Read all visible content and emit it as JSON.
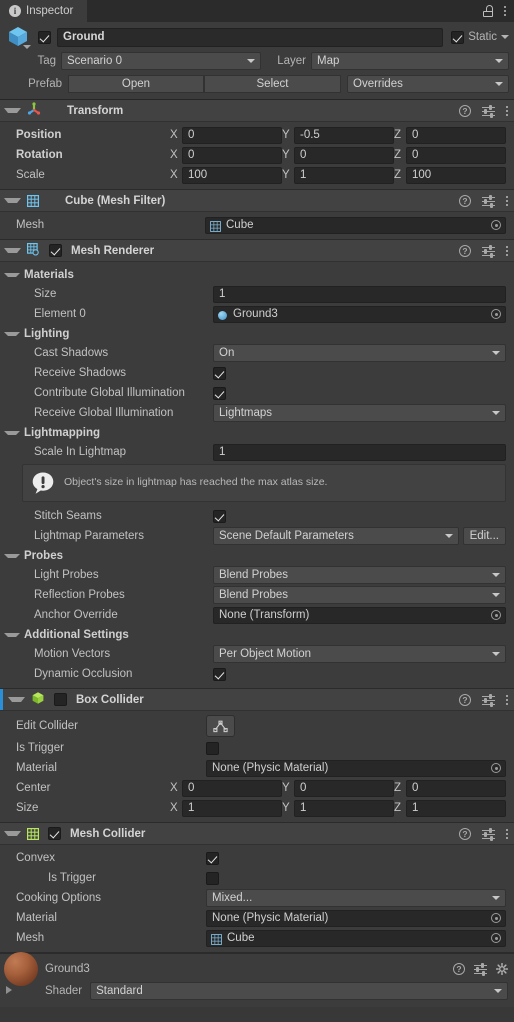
{
  "tabbar": {
    "tab_label": "Inspector",
    "info_glyph": "i",
    "lock_icon": "unlock-icon",
    "menu_icon": "kebab-menu-icon"
  },
  "gameobject": {
    "enabled": true,
    "name": "Ground",
    "static_label": "Static",
    "static_checked": true,
    "tag_label": "Tag",
    "tag_value": "Scenario 0",
    "layer_label": "Layer",
    "layer_value": "Map",
    "prefab_label": "Prefab",
    "prefab_open": "Open",
    "prefab_select": "Select",
    "prefab_overrides": "Overrides"
  },
  "components": [
    {
      "title": "Transform",
      "rows": [
        {
          "label": "Position",
          "bold": true,
          "x": "0",
          "y": "-0.5",
          "z": "0"
        },
        {
          "label": "Rotation",
          "bold": true,
          "x": "0",
          "y": "0",
          "z": "0"
        },
        {
          "label": "Scale",
          "bold": false,
          "x": "100",
          "y": "1",
          "z": "100"
        }
      ]
    },
    {
      "title": "Cube (Mesh Filter)",
      "mesh_label": "Mesh",
      "mesh_value": "Cube"
    },
    {
      "title": "Mesh Renderer",
      "enabled": true,
      "materials_section": "Materials",
      "size_label": "Size",
      "size_value": "1",
      "element0_label": "Element 0",
      "element0_value": "Ground3",
      "lighting_section": "Lighting",
      "cast_shadows_label": "Cast Shadows",
      "cast_shadows_value": "On",
      "receive_shadows_label": "Receive Shadows",
      "receive_shadows_checked": true,
      "contribute_gi_label": "Contribute Global Illumination",
      "contribute_gi_checked": true,
      "receive_gi_label": "Receive Global Illumination",
      "receive_gi_value": "Lightmaps",
      "lightmapping_section": "Lightmapping",
      "scale_in_lightmap_label": "Scale In Lightmap",
      "scale_in_lightmap_value": "1",
      "lightmap_warning": "Object's size in lightmap has reached the max atlas size.",
      "stitch_seams_label": "Stitch Seams",
      "stitch_seams_checked": true,
      "lightmap_params_label": "Lightmap Parameters",
      "lightmap_params_value": "Scene Default Parameters",
      "lightmap_params_edit": "Edit...",
      "probes_section": "Probes",
      "light_probes_label": "Light Probes",
      "light_probes_value": "Blend Probes",
      "reflection_probes_label": "Reflection Probes",
      "reflection_probes_value": "Blend Probes",
      "anchor_override_label": "Anchor Override",
      "anchor_override_value": "None (Transform)",
      "additional_section": "Additional Settings",
      "motion_vectors_label": "Motion Vectors",
      "motion_vectors_value": "Per Object Motion",
      "dynamic_occlusion_label": "Dynamic Occlusion",
      "dynamic_occlusion_checked": true
    },
    {
      "title": "Box Collider",
      "enabled": false,
      "edit_collider_label": "Edit Collider",
      "is_trigger_label": "Is Trigger",
      "is_trigger_checked": false,
      "material_label": "Material",
      "material_value": "None (Physic Material)",
      "center_label": "Center",
      "center": {
        "x": "0",
        "y": "0",
        "z": "0"
      },
      "size_label": "Size",
      "size": {
        "x": "1",
        "y": "1",
        "z": "1"
      }
    },
    {
      "title": "Mesh Collider",
      "enabled": true,
      "convex_label": "Convex",
      "convex_checked": true,
      "is_trigger_label": "Is Trigger",
      "is_trigger_checked": false,
      "cooking_options_label": "Cooking Options",
      "cooking_options_value": "Mixed...",
      "material_label": "Material",
      "material_value": "None (Physic Material)",
      "mesh_label": "Mesh",
      "mesh_value": "Cube"
    }
  ],
  "material_footer": {
    "name": "Ground3",
    "shader_label": "Shader",
    "shader_value": "Standard"
  },
  "axis_labels": {
    "x": "X",
    "y": "Y",
    "z": "Z"
  },
  "colors": {
    "accent": "#2b8fd8",
    "panel": "#3c3c3c",
    "header": "#424242",
    "field": "#282828",
    "popup": "#4b4b4b"
  }
}
